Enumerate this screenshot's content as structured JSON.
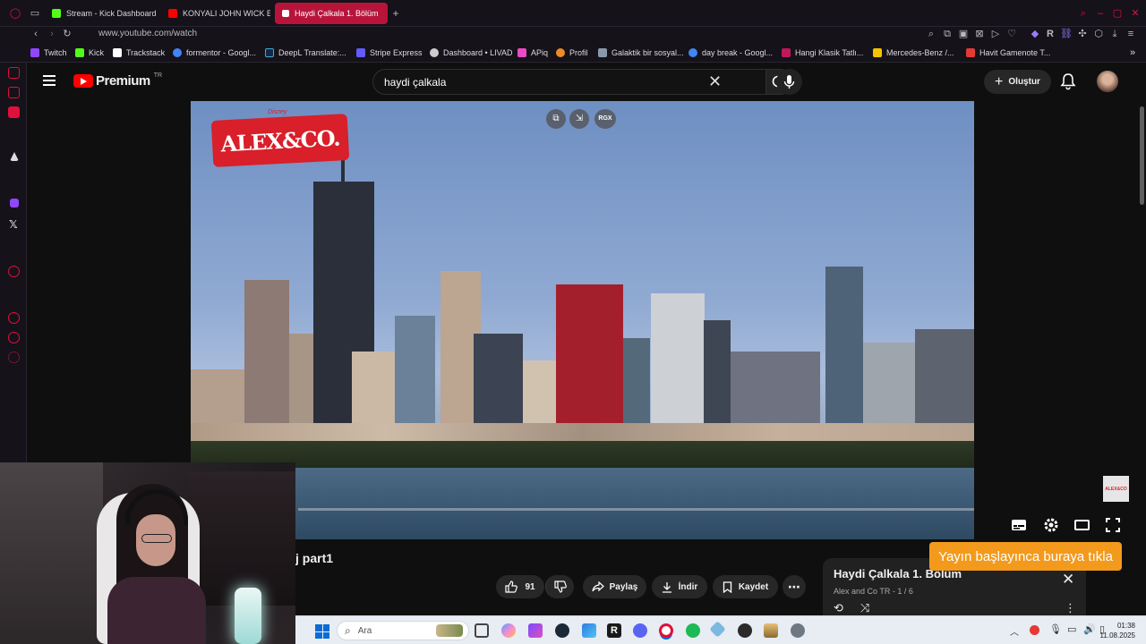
{
  "browser": {
    "tabs": [
      {
        "label": "Stream - Kick Dashboard",
        "color": "#53fc18"
      },
      {
        "label": "KONYALI JOHN WICK EV",
        "color": "#ff0000"
      },
      {
        "label": "Haydi Çalkala 1. Bölüm",
        "color": "#ff0000"
      }
    ],
    "new_tab": "+",
    "url": "www.youtube.com/watch",
    "bookmarks": [
      {
        "label": "Twitch",
        "color": "#9146ff"
      },
      {
        "label": "Kick",
        "color": "#53fc18"
      },
      {
        "label": "Trackstack",
        "color": "#ffffff"
      },
      {
        "label": "formentor - Googl...",
        "color": "#4285f4"
      },
      {
        "label": "DeepL Translate:...",
        "color": "#0f2b46"
      },
      {
        "label": "Stripe Express",
        "color": "#635bff"
      },
      {
        "label": "Dashboard • LIVAD",
        "color": "#cccccc"
      },
      {
        "label": "APiq",
        "color": "#e94cc4"
      },
      {
        "label": "Profil",
        "color": "#f08a24"
      },
      {
        "label": "Galaktik bir sosyal...",
        "color": "#8899aa"
      },
      {
        "label": "day break - Googl...",
        "color": "#4285f4"
      },
      {
        "label": "Hangi Klasik Tatlı...",
        "color": "#c2185b"
      },
      {
        "label": "Mercedes-Benz /...",
        "color": "#f5c400"
      },
      {
        "label": "Havit Gamenote T...",
        "color": "#e53935"
      }
    ],
    "bookmark_more": "»"
  },
  "youtube": {
    "logo_text": "Premium",
    "logo_region": "TR",
    "search_value": "haydi çalkala",
    "create_label": "Oluştur",
    "accent": "#ff0000"
  },
  "video": {
    "brand_small": "Disney",
    "brand_logo": "ALEX&CO.",
    "overlay_label": "RGX",
    "corner_badge": "ALEX&CO",
    "title_visible": "j part1"
  },
  "actions": {
    "likes": "91",
    "share": "Paylaş",
    "download": "İndir",
    "save": "Kaydet",
    "more": "⋯"
  },
  "playlist": {
    "title": "Haydi Çalkala 1. Bölüm",
    "subtitle": "Alex and Co TR - 1 / 6"
  },
  "overlay_button": "Yayın başlayınca buraya tıkla",
  "taskbar": {
    "search_placeholder": "Ara",
    "time": "01:38",
    "date": "11.08.2025"
  }
}
